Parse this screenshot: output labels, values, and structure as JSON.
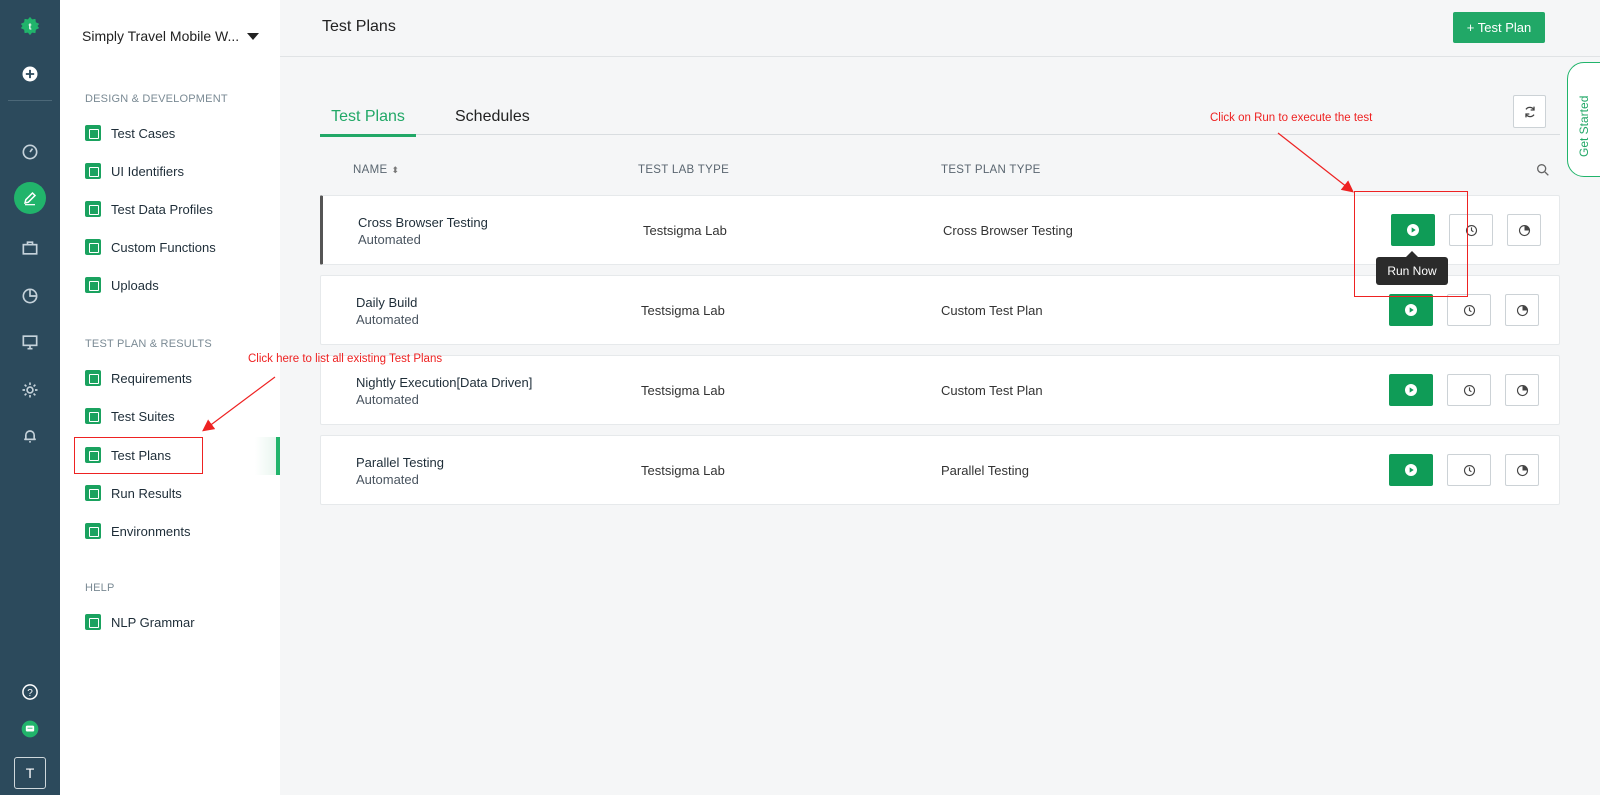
{
  "rail": {
    "icons": [
      "logo-icon",
      "add-icon",
      "dashboard-icon",
      "edit-icon",
      "briefcase-icon",
      "pie-chart-icon",
      "monitor-icon",
      "settings-icon",
      "bell-icon",
      "help-icon",
      "chat-icon"
    ],
    "avatar": "T"
  },
  "sidebar": {
    "project": "Simply Travel Mobile W...",
    "sections": [
      {
        "title": "DESIGN & DEVELOPMENT",
        "items": [
          "Test Cases",
          "UI Identifiers",
          "Test Data Profiles",
          "Custom Functions",
          "Uploads"
        ]
      },
      {
        "title": "TEST PLAN & RESULTS",
        "items": [
          "Requirements",
          "Test Suites",
          "Test Plans",
          "Run Results",
          "Environments"
        ]
      },
      {
        "title": "HELP",
        "items": [
          "NLP Grammar"
        ]
      }
    ]
  },
  "header": {
    "title": "Test Plans",
    "add_button": "+ Test Plan"
  },
  "tabs": [
    "Test Plans",
    "Schedules"
  ],
  "get_started": "Get Started",
  "table": {
    "columns": [
      "NAME",
      "TEST LAB TYPE",
      "TEST PLAN TYPE"
    ],
    "rows": [
      {
        "name": "Cross Browser Testing",
        "type": "Automated",
        "lab": "Testsigma Lab",
        "plan_type": "Cross Browser Testing"
      },
      {
        "name": "Daily Build",
        "type": "Automated",
        "lab": "Testsigma Lab",
        "plan_type": "Custom Test Plan"
      },
      {
        "name": "Nightly Execution[Data Driven]",
        "type": "Automated",
        "lab": "Testsigma Lab",
        "plan_type": "Custom Test Plan"
      },
      {
        "name": "Parallel Testing",
        "type": "Automated",
        "lab": "Testsigma Lab",
        "plan_type": "Parallel Testing"
      }
    ]
  },
  "tooltip": "Run Now",
  "annotations": {
    "run": "Click on Run to execute the test",
    "list": "Click here to list all existing Test Plans"
  },
  "colors": {
    "rail": "#2c4a5c",
    "brand_green": "#21a867",
    "annotation_red": "#ee2222"
  }
}
